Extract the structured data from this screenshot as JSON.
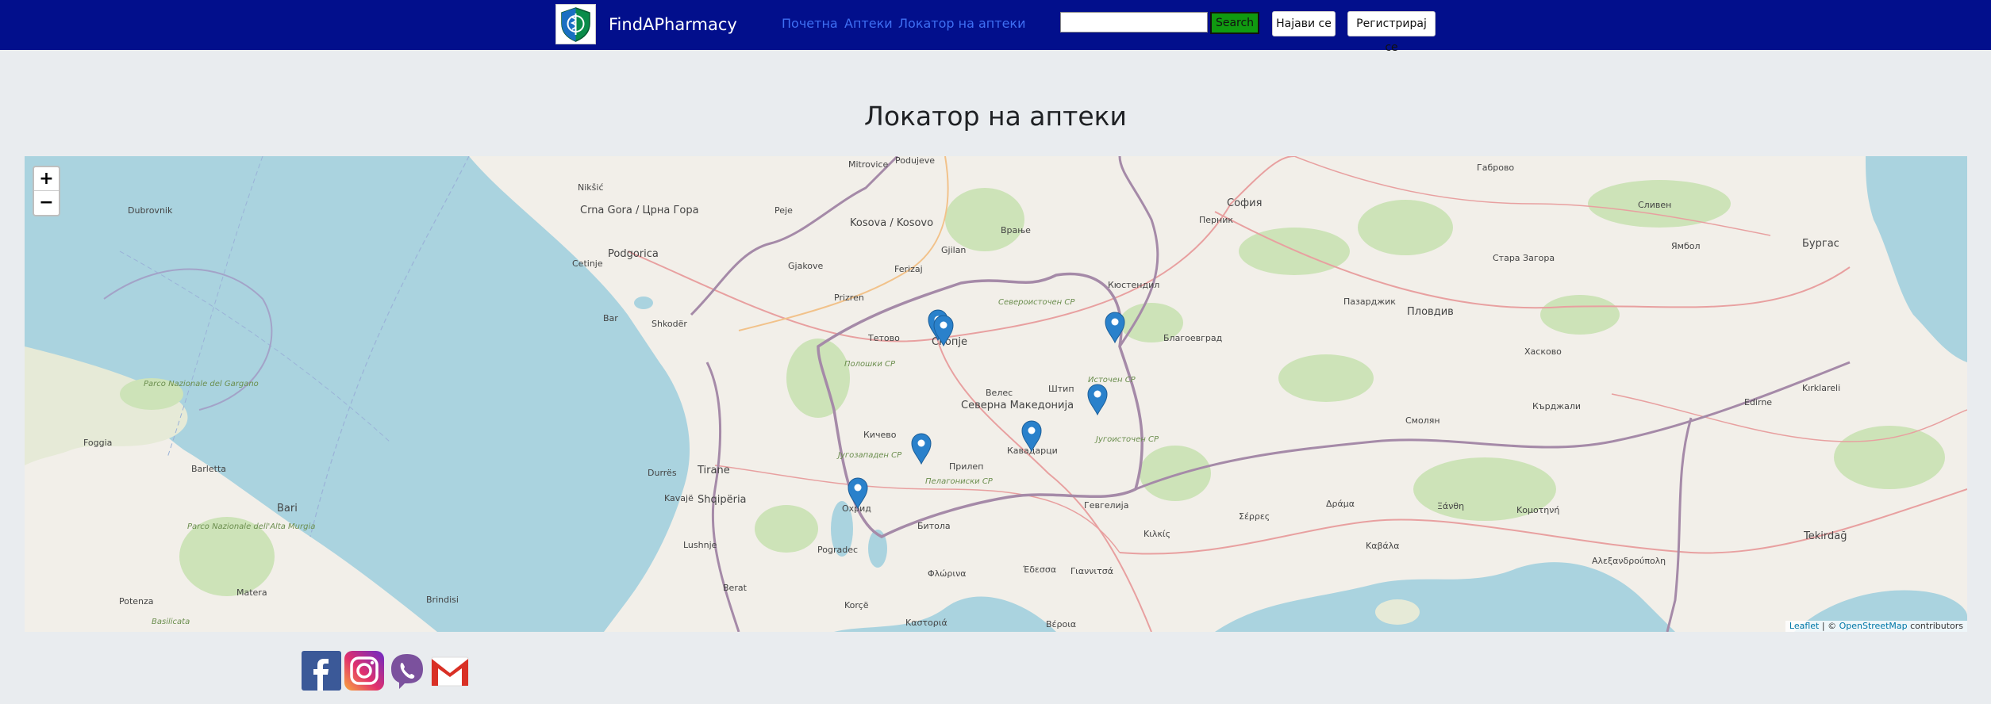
{
  "navbar": {
    "brand": "FindAPharmacy",
    "links": [
      "Почетна",
      "Аптеки",
      "Локатор на аптеки"
    ],
    "search_button": "Search",
    "search_value": "",
    "login_button": "Најави се",
    "register_button": "Регистрирај се"
  },
  "page": {
    "title": "Локатор на аптеки"
  },
  "map": {
    "zoom_in": "+",
    "zoom_out": "−",
    "attribution_leaflet": "Leaflet",
    "attribution_sep": " | © ",
    "attribution_osm": "OpenStreetMap",
    "attribution_suffix": " contributors",
    "labels": {
      "mitrovice": "Mitrovice",
      "podujeve": "Podujeve",
      "pec": "Peje",
      "kosova": "Kosova / Kosovo",
      "gjilan": "Gjilan",
      "vranje": "Врање",
      "sofija": "София",
      "pernik": "Перник",
      "kyustendil": "Кюстендил",
      "gabrovo": "Габрово",
      "sliven": "Сливен",
      "yambol": "Ямбол",
      "burgas": "Бургас",
      "stara_zagora": "Стара Загора",
      "pazardzhik": "Пазарджик",
      "plovdiv": "Пловдив",
      "blagoevgrad": "Благоевград",
      "haskovo": "Хасково",
      "smolyan": "Смолян",
      "kardzhali": "Кърджали",
      "edirne": "Edirne",
      "kirklareli": "Kırklareli",
      "tekirdag": "Tekirdağ",
      "dubrovnik": "Dubrovnik",
      "niksic": "Nikšić",
      "crna_gora": "Crna Gora / Црна Гора",
      "podgorica": "Podgorica",
      "cetinje": "Cetinje",
      "bar": "Bar",
      "shkoder": "Shkodër",
      "gjakove": "Gjakove",
      "prizren": "Prizren",
      "ferizaj": "Ferizaj",
      "tetovo": "Тетово",
      "skopje": "Скопје",
      "stip": "Штип",
      "veles": "Велес",
      "severna_makedonija": "Северна Македонија",
      "kicevo": "Кичево",
      "prilep": "Прилеп",
      "kavadarci": "Кавадарци",
      "ohrid": "Охрид",
      "bitola": "Битола",
      "pogradec": "Pogradec",
      "korce": "Korçë",
      "florina": "Φλώρινα",
      "edessa": "Έδεσσα",
      "giannitsa": "Γιαννιτσά",
      "verroia": "Βέροια",
      "kastoria": "Καστοριά",
      "gevgelija": "Гевгелија",
      "kilkis": "Κιλκίς",
      "serres": "Σέρρες",
      "drama": "Δράμα",
      "xanthi": "Ξάνθη",
      "komotini": "Κομοτηνή",
      "kavala": "Καβάλα",
      "alexandroupoli": "Αλεξανδρούπολη",
      "tirane": "Tirane",
      "durres": "Durrës",
      "shqiperia": "Shqipëria",
      "kavaje": "Kavajë",
      "lushnje": "Lushnje",
      "berat": "Berat",
      "foggia": "Foggia",
      "barletta": "Barletta",
      "bari": "Bari",
      "matera": "Matera",
      "potenza": "Potenza",
      "brindisi": "Brindisi",
      "basilicata": "Basilicata",
      "gargano": "Parco Nazionale del Gargano",
      "alta_murgia": "Parco Nazionale dell'Alta Murgia",
      "sev_region": "Северoисточен СР",
      "ist_region": "Источен СР",
      "jug_region": "Југоисточен СР",
      "jugzap_region": "Југозападен СР",
      "pelag_region": "Пелагониски СР",
      "polog_region": "Полошки СР"
    }
  }
}
